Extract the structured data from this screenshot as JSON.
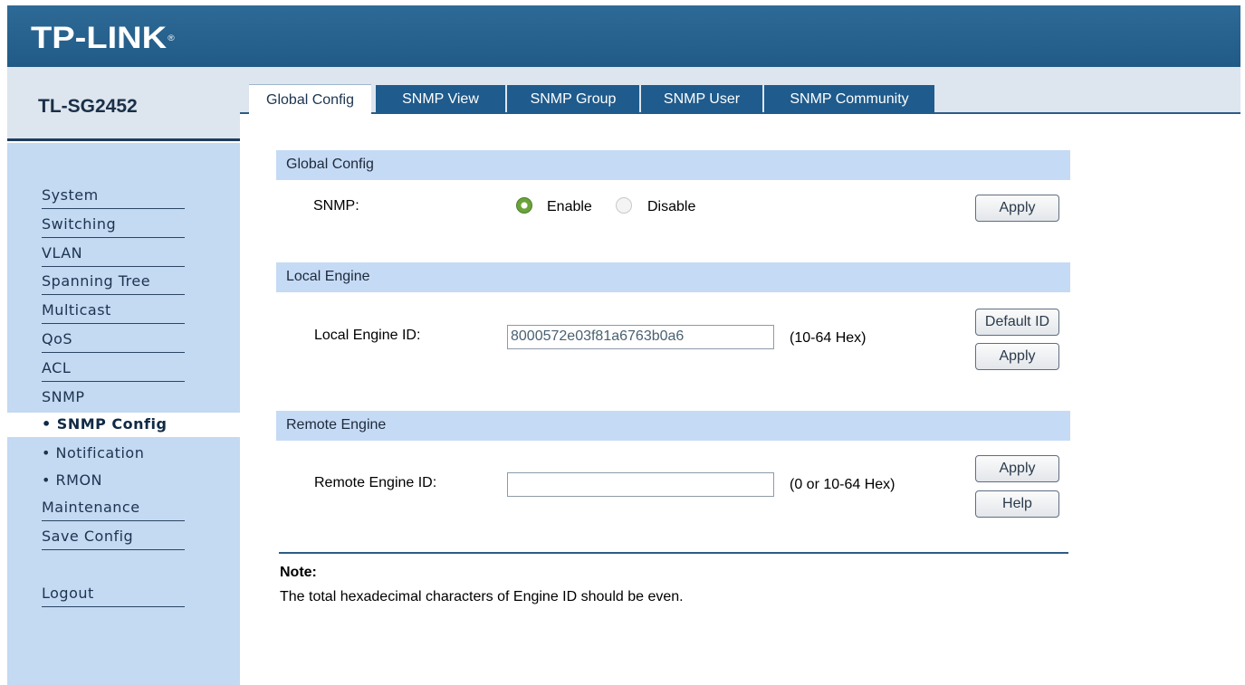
{
  "header": {
    "logo": "TP-LINK",
    "logo_mark": "®"
  },
  "model": "TL-SG2452",
  "sidebar": {
    "items": [
      {
        "label": "System"
      },
      {
        "label": "Switching"
      },
      {
        "label": "VLAN"
      },
      {
        "label": "Spanning Tree"
      },
      {
        "label": "Multicast"
      },
      {
        "label": "QoS"
      },
      {
        "label": "ACL"
      },
      {
        "label": "SNMP"
      }
    ],
    "subitems": [
      {
        "label": "• SNMP Config"
      },
      {
        "label": "• Notification"
      },
      {
        "label": "• RMON"
      }
    ],
    "bottom": [
      {
        "label": "Maintenance"
      },
      {
        "label": "Save Config"
      }
    ],
    "logout": "Logout"
  },
  "tabs": [
    {
      "label": "Global Config"
    },
    {
      "label": "SNMP View"
    },
    {
      "label": "SNMP Group"
    },
    {
      "label": "SNMP User"
    },
    {
      "label": "SNMP Community"
    }
  ],
  "global": {
    "title": "Global Config",
    "snmp_label": "SNMP:",
    "enable_label": "Enable",
    "disable_label": "Disable",
    "selected": "Enable",
    "apply": "Apply"
  },
  "local": {
    "title": "Local Engine",
    "id_label": "Local Engine ID:",
    "id_value": "8000572e03f81a6763b0a6",
    "hint": "(10-64 Hex)",
    "default_id": "Default ID",
    "apply": "Apply"
  },
  "remote": {
    "title": "Remote Engine",
    "id_label": "Remote Engine ID:",
    "id_value": "",
    "hint": "(0 or 10-64 Hex)",
    "apply": "Apply",
    "help": "Help"
  },
  "note": {
    "title": "Note:",
    "text": "The total hexadecimal characters of Engine ID should be even."
  },
  "colors": {
    "header_blue": "#215a86",
    "sidebar_bg": "#c4d9f2",
    "section_bg": "#c5daf5",
    "tab_blue": "#1f5b8c"
  }
}
